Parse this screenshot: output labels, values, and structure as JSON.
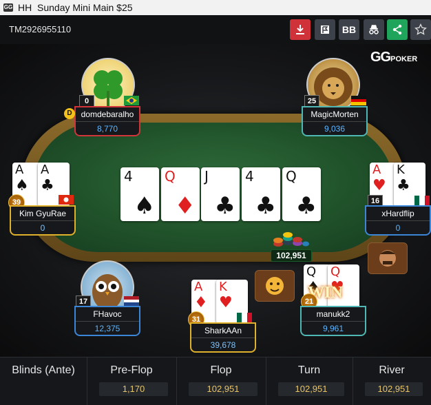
{
  "window": {
    "app_badge": "GG",
    "hh_label": "HH",
    "title": "Sunday Mini Main $25"
  },
  "toolbar": {
    "hand_id": "TM2926955110",
    "buttons": [
      {
        "icon": "download-icon"
      },
      {
        "icon": "flag-icon"
      },
      {
        "label": "BB"
      },
      {
        "icon": "incognito-icon"
      },
      {
        "icon": "share-icon"
      },
      {
        "icon": "star-icon"
      }
    ]
  },
  "logo": {
    "gg": "GG",
    "poker": "POKER"
  },
  "board": {
    "cards": [
      {
        "rank": "4",
        "suit": "♠",
        "color": "black"
      },
      {
        "rank": "Q",
        "suit": "♦",
        "color": "red"
      },
      {
        "rank": "J",
        "suit": "♣",
        "color": "black"
      },
      {
        "rank": "4",
        "suit": "♣",
        "color": "black"
      },
      {
        "rank": "Q",
        "suit": "♣",
        "color": "black"
      }
    ]
  },
  "pot": {
    "amount": "102,951"
  },
  "dealer_button": "D",
  "players": {
    "domdebaralho": {
      "name": "domdebaralho",
      "stack": "8,770",
      "level": "0",
      "flag": "Brazil"
    },
    "magicmorten": {
      "name": "MagicMorten",
      "stack": "9,036",
      "level": "25",
      "flag": "Germany"
    },
    "kimgyurae": {
      "name": "Kim GyuRae",
      "stack": "0",
      "level": "39",
      "flag": "Hong Kong",
      "cards": [
        {
          "rank": "A",
          "suit": "♠"
        },
        {
          "rank": "A",
          "suit": "♣"
        }
      ]
    },
    "xhardflip": {
      "name": "xHardflip",
      "stack": "0",
      "level": "16",
      "flag": "Mexico",
      "cards": [
        {
          "rank": "A",
          "suit": "♥"
        },
        {
          "rank": "K",
          "suit": "♣"
        }
      ]
    },
    "fhavoc": {
      "name": "FHavoc",
      "stack": "12,375",
      "level": "17",
      "flag": "Netherlands"
    },
    "sharkaan": {
      "name": "SharkAAn",
      "stack": "39,678",
      "level": "31",
      "flag": "Mexico",
      "cards": [
        {
          "rank": "A",
          "suit": "♦"
        },
        {
          "rank": "K",
          "suit": "♥"
        }
      ]
    },
    "manukk2": {
      "name": "manukk2",
      "stack": "9,961",
      "level": "21",
      "cards": [
        {
          "rank": "Q",
          "suit": "♠"
        },
        {
          "rank": "Q",
          "suit": "♥"
        }
      ],
      "win_label": "WIN"
    }
  },
  "footer": {
    "columns": [
      {
        "label": "Blinds (Ante)",
        "value": ""
      },
      {
        "label": "Pre-Flop",
        "value": "1,170"
      },
      {
        "label": "Flop",
        "value": "102,951"
      },
      {
        "label": "Turn",
        "value": "102,951"
      },
      {
        "label": "River",
        "value": "102,951"
      }
    ]
  },
  "colors": {
    "plate_red": "#d2343a",
    "plate_teal": "#4fb8b4",
    "plate_blue": "#3c86d8",
    "plate_yellow": "#e0b12a",
    "stack_blue": "#5cb6ff",
    "footer_value": "#e8c56a"
  }
}
